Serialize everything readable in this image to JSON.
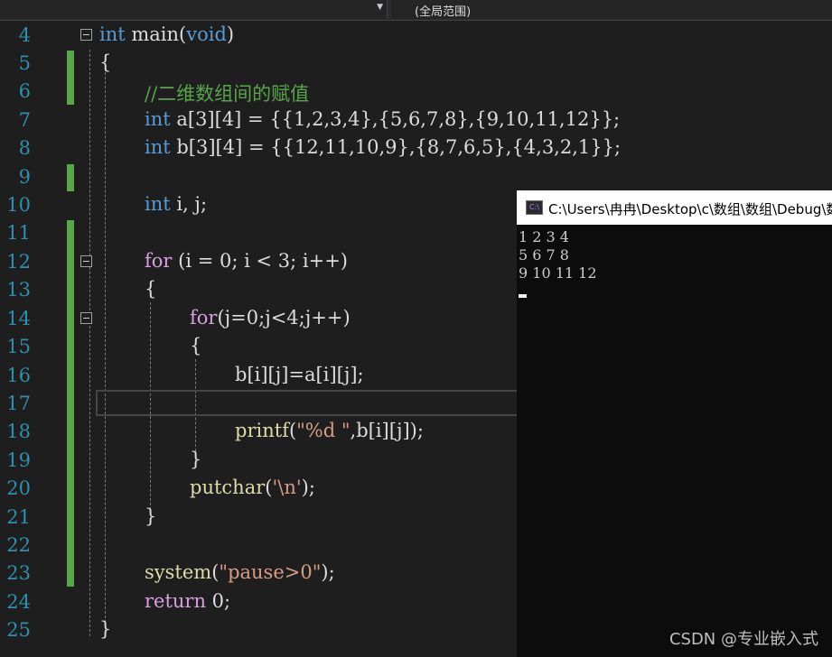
{
  "toolbar": {
    "scope_dropdown": "(全局范围)"
  },
  "editor": {
    "line_numbers": [
      "4",
      "5",
      "6",
      "7",
      "8",
      "9",
      "10",
      "11",
      "12",
      "13",
      "14",
      "15",
      "16",
      "17",
      "18",
      "19",
      "20",
      "21",
      "22",
      "23",
      "24",
      "25"
    ],
    "code": {
      "l4_kw": "int",
      "l4_rest": " main(",
      "l4_void": "void",
      "l4_close": ")",
      "l5": "{",
      "l6": "//二维数组间的赋值",
      "l7_kw": "int",
      "l7_rest": " a[3][4] = {{1,2,3,4},{5,6,7,8},{9,10,11,12}};",
      "l8_kw": "int",
      "l8_rest": " b[3][4] = {{12,11,10,9},{8,7,6,5},{4,3,2,1}};",
      "l10_kw": "int",
      "l10_rest": " i, j;",
      "l12_kw": "for",
      "l12_rest": " (i = 0; i < 3; i++)",
      "l13": "{",
      "l14_kw": "for",
      "l14_rest": "(j=0;j<4;j++)",
      "l15": "{",
      "l16": "b[i][j]=a[i][j];",
      "l18_fn": "printf",
      "l18_open": "(",
      "l18_str": "\"%d \"",
      "l18_rest": ",b[i][j]);",
      "l19": "}",
      "l20_fn": "putchar",
      "l20_open": "(",
      "l20_str": "'\\n'",
      "l20_rest": ");",
      "l21": "}",
      "l23_fn": "system",
      "l23_open": "(",
      "l23_str": "\"pause>0\"",
      "l23_rest": ");",
      "l24_kw": "return",
      "l24_rest": " 0;",
      "l25": "}"
    }
  },
  "console": {
    "title": "C:\\Users\\冉冉\\Desktop\\c\\数组\\数组\\Debug\\数",
    "icon_label": "C:\\",
    "output_line1": "1 2 3 4",
    "output_line2": "5 6 7 8",
    "output_line3": "9 10 11 12"
  },
  "watermark": "CSDN @专业嵌入式",
  "colors": {
    "background": "#1e1e1e",
    "keyword": "#569cd6",
    "comment": "#57a64a",
    "string": "#d69d85",
    "line_number": "#2b91af",
    "function": "#dcdcaa"
  }
}
